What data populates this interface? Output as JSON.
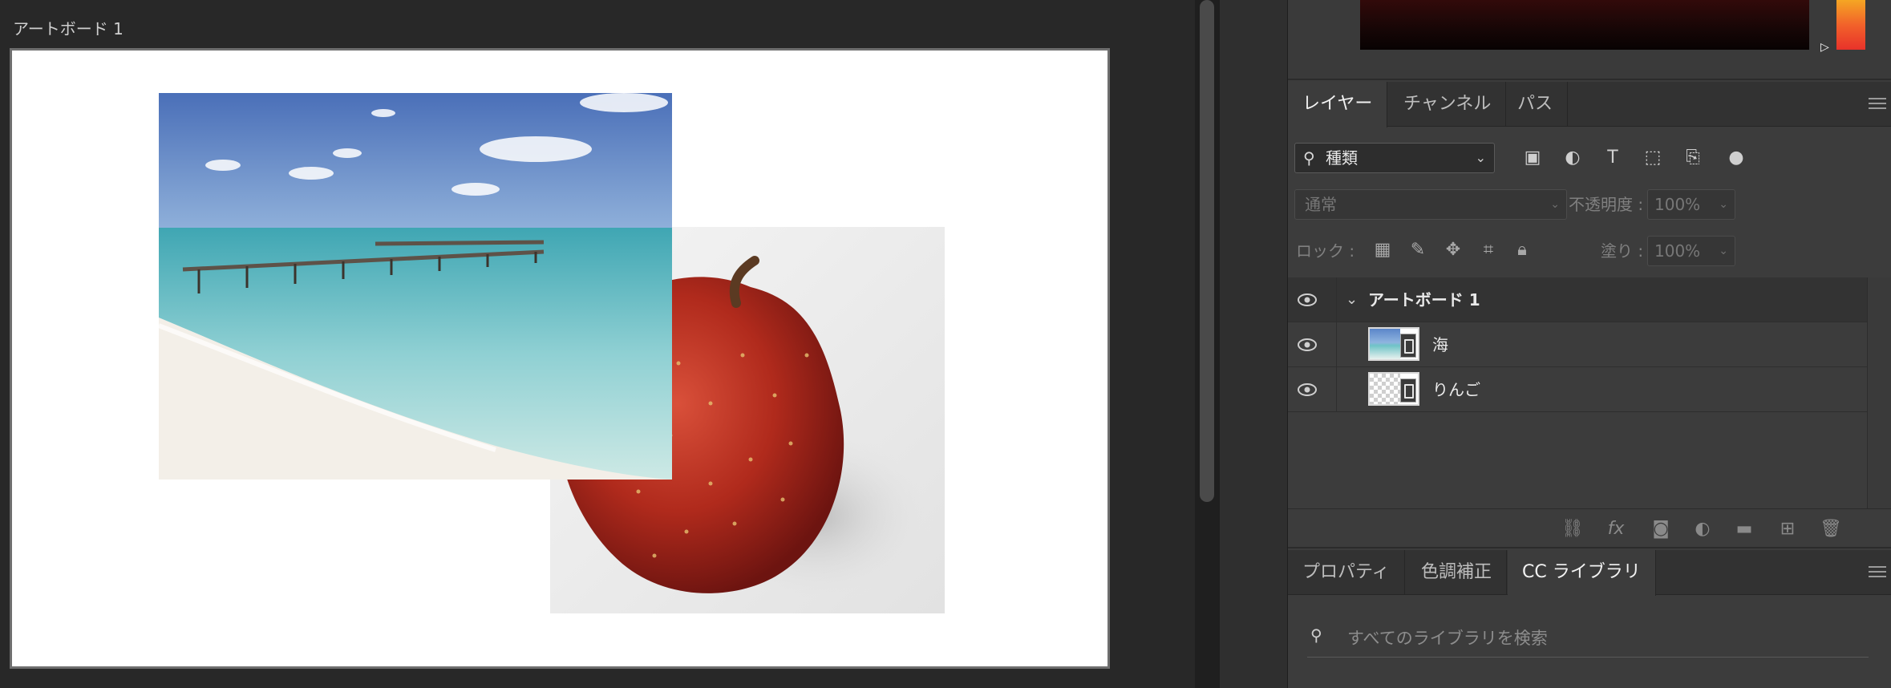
{
  "artboard": {
    "title": "アートボード 1"
  },
  "panels": {
    "layers_tabs": [
      "レイヤー",
      "チャンネル",
      "パス"
    ],
    "properties_tabs": [
      "プロパティ",
      "色調補正",
      "CC ライブラリ"
    ]
  },
  "layers": {
    "filter_kind": "種類",
    "blend_mode": "通常",
    "opacity_label": "不透明度 :",
    "opacity_value": "100%",
    "lock_label": "ロック :",
    "fill_label": "塗り :",
    "fill_value": "100%",
    "group_name": "アートボード 1",
    "items": [
      {
        "name": "海"
      },
      {
        "name": "りんご"
      }
    ]
  },
  "library": {
    "search_placeholder": "すべてのライブラリを検索"
  },
  "icons": {
    "filter": [
      "image-filter-icon",
      "adjustment-filter-icon",
      "type-filter-icon",
      "shape-filter-icon",
      "smart-object-filter-icon",
      "filter-toggle-icon"
    ],
    "lock": [
      "lock-transparent-pixels-icon",
      "lock-image-pixels-icon",
      "lock-position-icon",
      "lock-artboard-icon",
      "lock-all-icon"
    ],
    "bottom": [
      "link-layers-icon",
      "fx-icon",
      "add-mask-icon",
      "new-adjustment-layer-icon",
      "new-group-icon",
      "new-layer-icon",
      "delete-layer-icon"
    ]
  },
  "colors": {
    "accent_hue_top": "#f5a623",
    "accent_hue_bottom": "#e8322a",
    "panel_bg": "#3c3c3c",
    "canvas_bg": "#282828"
  }
}
